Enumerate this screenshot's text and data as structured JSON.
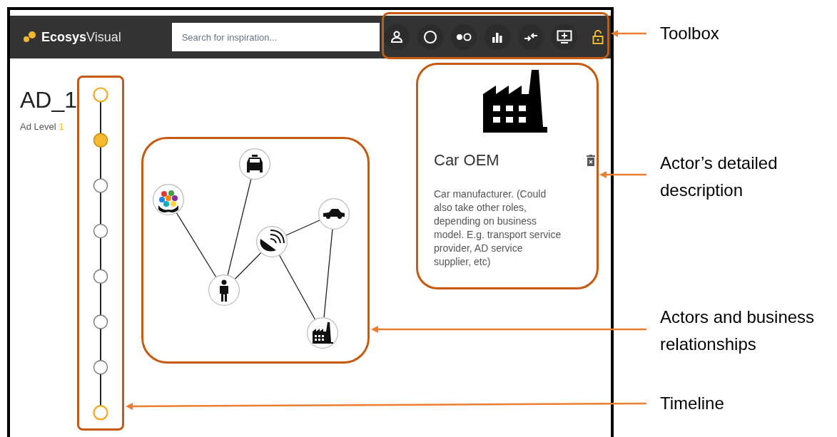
{
  "app": {
    "logo": {
      "bold": "Ecosys",
      "rest": "Visual"
    },
    "search": {
      "placeholder": "Search for inspiration..."
    },
    "scenario": {
      "title": "AD_1",
      "level_label": "Ad Level",
      "level_value": "1"
    },
    "timeline": [
      {
        "kind": "end",
        "selected": false
      },
      {
        "kind": "step",
        "selected": true
      },
      {
        "kind": "step",
        "selected": false
      },
      {
        "kind": "step",
        "selected": false
      },
      {
        "kind": "step",
        "selected": false
      },
      {
        "kind": "step",
        "selected": false
      },
      {
        "kind": "step",
        "selected": false
      },
      {
        "kind": "end",
        "selected": false
      }
    ],
    "actor_card": {
      "title": "Car OEM",
      "description": "Car manufacturer. (Could also take other roles, depending on business model. E.g. transport service provider, AD service supplier, etc)"
    }
  },
  "annotations": [
    {
      "label": "Toolbox"
    },
    {
      "label": "Actor’s detailed description"
    },
    {
      "label": "Actors and business relationships"
    },
    {
      "label": "Timeline"
    }
  ]
}
